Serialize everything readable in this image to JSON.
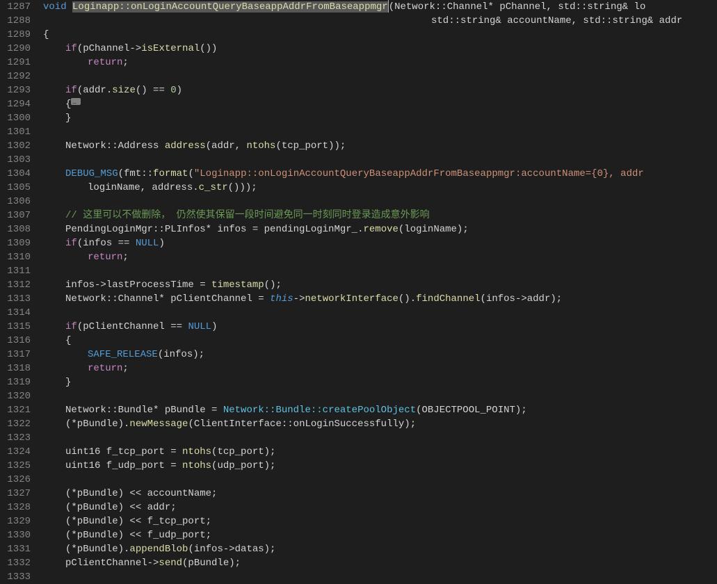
{
  "gutter": [
    "1287",
    "1288",
    "1289",
    "1290",
    "1291",
    "1292",
    "1293",
    "1294",
    "1300",
    "1301",
    "1302",
    "1303",
    "1304",
    "1305",
    "1306",
    "1307",
    "1308",
    "1309",
    "1310",
    "1311",
    "1312",
    "1313",
    "1314",
    "1315",
    "1316",
    "1317",
    "1318",
    "1319",
    "1320",
    "1321",
    "1322",
    "1323",
    "1324",
    "1325",
    "1326",
    "1327",
    "1328",
    "1329",
    "1330",
    "1331",
    "1332",
    "1333"
  ],
  "t": {
    "void": "void",
    "fnsig": "Loginapp::onLoginAccountQueryBaseappAddrFromBaseappmgr",
    "sig_tail1a": "(Network::Channel* pChannel, std::string& lo",
    "sig_tail2": "std::string& accountName, std::string& addr",
    "if1_a": "if",
    "if1_b": "(pChannel->",
    "isExternal": "isExternal",
    "if1_c": "())",
    "return": "return",
    "semi": ";",
    "if2_a": "if",
    "if2_b": "(addr.",
    "size": "size",
    "if2_c": "() == ",
    "zero": "0",
    "if2_d": ")",
    "netaddr_a": "Network::Address ",
    "address_var": "address",
    "netaddr_b": "(addr, ",
    "ntohs": "ntohs",
    "netaddr_c": "(tcp_port));",
    "debug_msg": "DEBUG_MSG",
    "dm_b": "(fmt::",
    "format": "format",
    "dm_c": "(",
    "dm_str": "\"Loginapp::onLoginAccountQueryBaseappAddrFromBaseappmgr:accountName={0}, addr",
    "dm2_a": "loginName, address.",
    "c_str": "c_str",
    "dm2_b": "()));",
    "comment": "// 这里可以不做删除，  仍然使其保留一段时间避免同一时刻同时登录造成意外影响",
    "pend_a": "PendingLoginMgr::PLInfos* infos = pendingLoginMgr_.",
    "remove": "remove",
    "pend_b": "(loginName);",
    "if3_a": "if",
    "if3_b": "(infos == ",
    "NULL": "NULL",
    "if3_c": ")",
    "lpt_a": "infos->lastProcessTime = ",
    "timestamp": "timestamp",
    "lpt_b": "();",
    "chan_a": "Network::Channel* pClientChannel = ",
    "this": "this",
    "chan_b": "->",
    "networkInterface": "networkInterface",
    "chan_c": "().",
    "findChannel": "findChannel",
    "chan_d": "(infos->addr);",
    "if4_a": "if",
    "if4_b": "(pClientChannel == ",
    "if4_c": ")",
    "safe_a": "SAFE_RELEASE",
    "safe_b": "(infos);",
    "bun_a": "Network::Bundle* pBundle = ",
    "createPool": "Network::Bundle::createPoolObject",
    "bun_b": "(OBJECTPOOL_POINT);",
    "nm_a": "(*pBundle).",
    "newMessage": "newMessage",
    "nm_b": "(ClientInterface::onLoginSuccessfully);",
    "u16a_a": "uint16 f_tcp_port = ",
    "u16a_b": "(tcp_port);",
    "u16b_a": "uint16 f_udp_port = ",
    "u16b_b": "(udp_port);",
    "s1": "(*pBundle) << accountName;",
    "s2": "(*pBundle) << addr;",
    "s3": "(*pBundle) << f_tcp_port;",
    "s4": "(*pBundle) << f_udp_port;",
    "ab_a": "(*pBundle).",
    "appendBlob": "appendBlob",
    "ab_b": "(infos->datas);",
    "snd_a": "pClientChannel->",
    "send": "send",
    "snd_b": "(pBundle);",
    "lbrace": "{",
    "rbrace": "}",
    "sp": " "
  }
}
